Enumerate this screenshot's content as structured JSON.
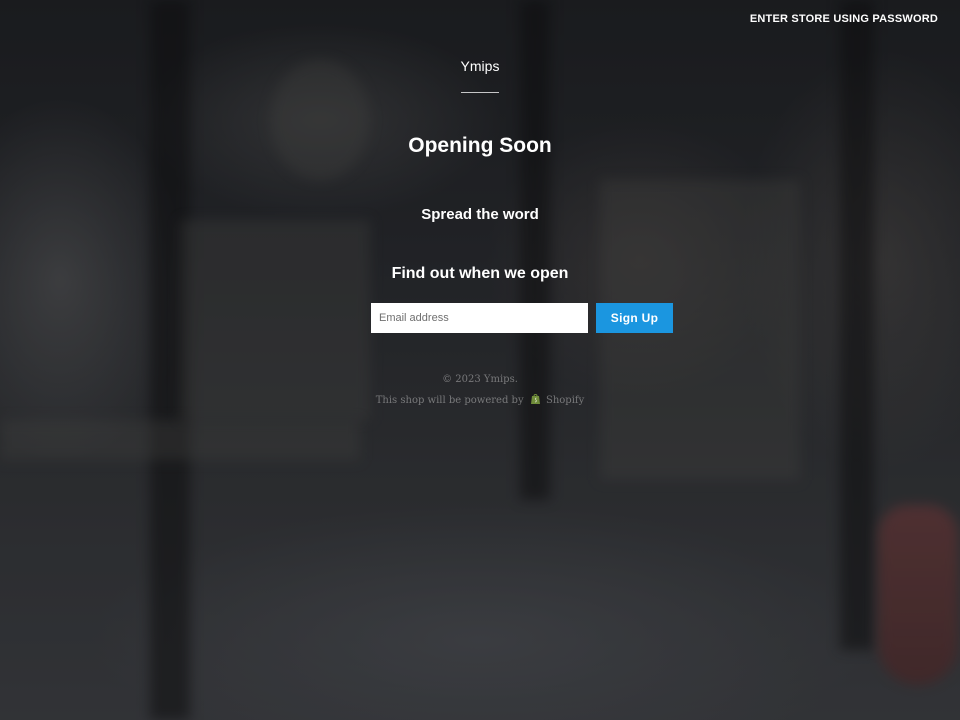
{
  "header": {
    "enter_link": "ENTER STORE USING PASSWORD"
  },
  "brand": {
    "name": "Ymips"
  },
  "main": {
    "heading": "Opening Soon",
    "spread_text": "Spread the word",
    "signup_heading": "Find out when we open",
    "email_placeholder": "Email address",
    "email_value": "",
    "signup_label": "Sign Up"
  },
  "footer": {
    "copyright": "© 2023 Ymips.",
    "powered_prefix": "This shop will be powered by",
    "shopify_label": "Shopify",
    "shopify_icon": "shopify-bag-icon"
  },
  "colors": {
    "accent": "#1b96e0",
    "text": "#ffffff"
  }
}
